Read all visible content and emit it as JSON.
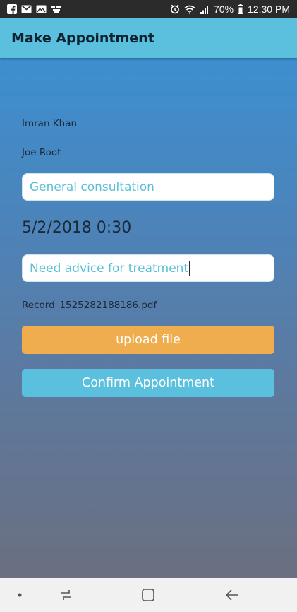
{
  "status_bar": {
    "left_icons": [
      "facebook-icon",
      "gmail-icon",
      "mail-icon",
      "app-notification-icon"
    ],
    "right_icons": [
      "alarm-icon",
      "wifi-icon",
      "signal-icon",
      "battery-icon"
    ],
    "battery": "70%",
    "time": "12:30 PM"
  },
  "app_bar": {
    "title": "Make Appointment"
  },
  "form": {
    "patient_name": "Imran Khan",
    "doctor_name": "Joe Root",
    "consultation_type": "General consultation",
    "datetime": "5/2/2018 0:30",
    "notes": "Need advice for treatment",
    "file_name": "Record_1525282188186.pdf",
    "upload_label": "upload file",
    "confirm_label": "Confirm Appointment"
  },
  "nav_bar": {
    "icons": [
      "dot-icon",
      "recent-apps-icon",
      "home-icon",
      "back-icon"
    ]
  },
  "colors": {
    "status_bar": "#2b2b2b",
    "app_bar": "#5bc0de",
    "upload_button": "#efad4e",
    "confirm_button": "#5bc0de",
    "input_text": "#5bbfd8"
  }
}
